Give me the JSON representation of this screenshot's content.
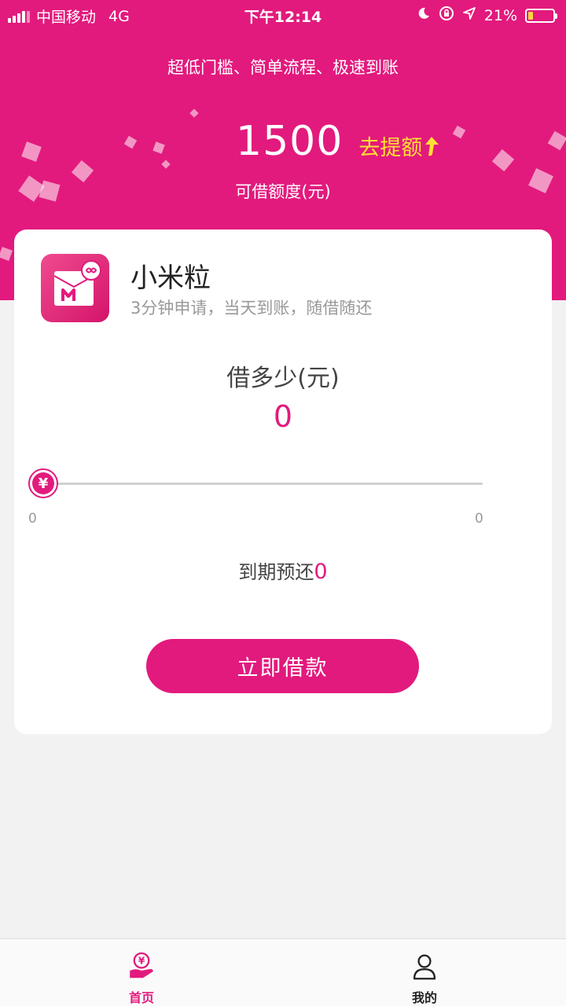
{
  "status_bar": {
    "carrier": "中国移动",
    "network": "4G",
    "time": "下午12:14",
    "battery": "21%",
    "battery_level": 0.21
  },
  "header": {
    "tagline": "超低门槛、简单流程、极速到账",
    "credit_amount": "1500",
    "raise_link": "去提额",
    "credit_label": "可借额度(元)",
    "accent_color": "#e21a7d"
  },
  "product": {
    "name": "小米粒",
    "description": "3分钟申请，当天到账，随借随还",
    "logo_icon": "envelope-m-icon"
  },
  "loan": {
    "question_label": "借多少(元)",
    "amount": "0",
    "slider_min": "0",
    "slider_max": "0",
    "slider_level": 0,
    "slider_thumb_glyph": "¥",
    "due_label": "到期预还",
    "due_value": "0",
    "submit_label": "立即借款"
  },
  "nav": {
    "items": [
      {
        "label": "首页",
        "icon": "hand-yen-icon",
        "active": true
      },
      {
        "label": "我的",
        "icon": "person-icon",
        "active": false
      }
    ]
  }
}
